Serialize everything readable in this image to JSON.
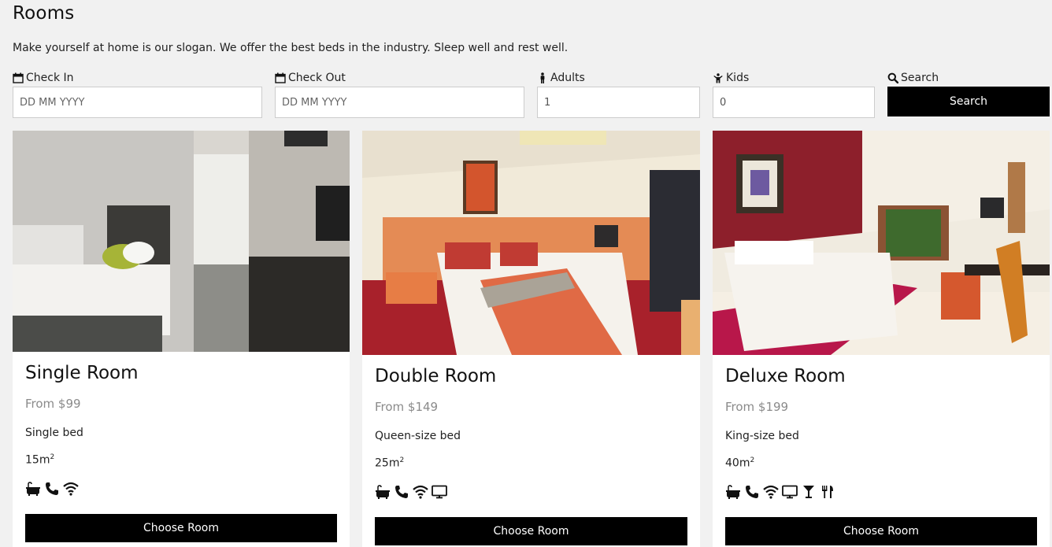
{
  "header": {
    "title": "Rooms",
    "slogan": "Make yourself at home is our slogan. We offer the best beds in the industry. Sleep well and rest well."
  },
  "search": {
    "check_in": {
      "label": "Check In",
      "placeholder": "DD MM YYYY",
      "icon": "calendar-icon"
    },
    "check_out": {
      "label": "Check Out",
      "placeholder": "DD MM YYYY",
      "icon": "calendar-icon"
    },
    "adults": {
      "label": "Adults",
      "value": "1",
      "icon": "male-icon"
    },
    "kids": {
      "label": "Kids",
      "value": "0",
      "icon": "child-icon"
    },
    "search": {
      "label": "Search",
      "button_label": "Search",
      "icon": "search-icon"
    }
  },
  "rooms": [
    {
      "name": "Single Room",
      "price": "From $99",
      "bed": "Single bed",
      "size": "15m",
      "size_unit_sup": "2",
      "amenities": [
        "bath-icon",
        "phone-icon",
        "wifi-icon"
      ],
      "button_label": "Choose Room",
      "photo_palette": [
        "#3a3a3a",
        "#e9e7e2",
        "#b9b9b0"
      ]
    },
    {
      "name": "Double Room",
      "price": "From $149",
      "bed": "Queen-size bed",
      "size": "25m",
      "size_unit_sup": "2",
      "amenities": [
        "bath-icon",
        "phone-icon",
        "wifi-icon",
        "tv-icon"
      ],
      "button_label": "Choose Room",
      "photo_palette": [
        "#a82a2a",
        "#f3e9dc",
        "#e57a4b"
      ]
    },
    {
      "name": "Deluxe Room",
      "price": "From $199",
      "bed": "King-size bed",
      "size": "40m",
      "size_unit_sup": "2",
      "amenities": [
        "bath-icon",
        "phone-icon",
        "wifi-icon",
        "tv-icon",
        "cocktail-icon",
        "cutlery-icon"
      ],
      "button_label": "Choose Room",
      "photo_palette": [
        "#8b1e2b",
        "#f2ece1",
        "#c13b5a"
      ]
    }
  ],
  "colors": {
    "background": "#f1f1f1",
    "button": "#000000",
    "button_text": "#ffffff",
    "price": "#8a8a8a"
  }
}
